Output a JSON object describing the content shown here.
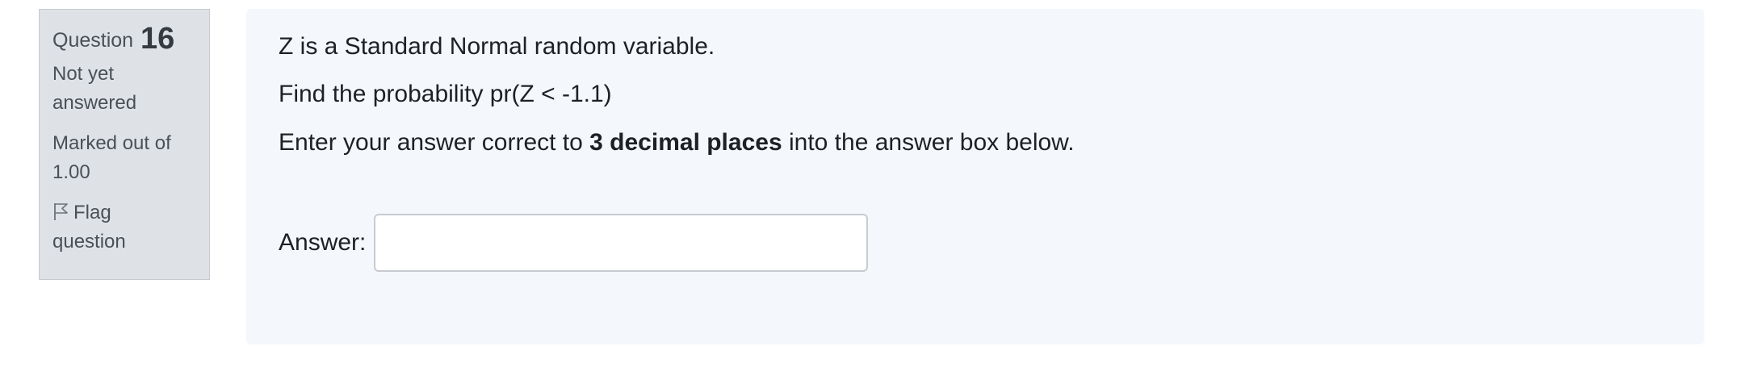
{
  "question_info": {
    "label": "Question",
    "number": "16",
    "state_line1": "Not yet",
    "state_line2": "answered",
    "grade_line1": "Marked out of",
    "grade_line2": "1.00",
    "flag_line1": "Flag",
    "flag_line2": "question",
    "flag_icon": "flag-outline-icon"
  },
  "question": {
    "line1": "Z is a Standard Normal random variable.",
    "line2": "Find the probability pr(Z < -1.1)",
    "line3_before": "Enter your answer correct to ",
    "line3_bold": "3 decimal places",
    "line3_after": " into the answer box below."
  },
  "answer": {
    "label": "Answer:",
    "value": "",
    "placeholder": ""
  },
  "colors": {
    "info_bg": "#dee2e6",
    "content_bg": "#f4f7fc",
    "text": "#1d2125"
  }
}
